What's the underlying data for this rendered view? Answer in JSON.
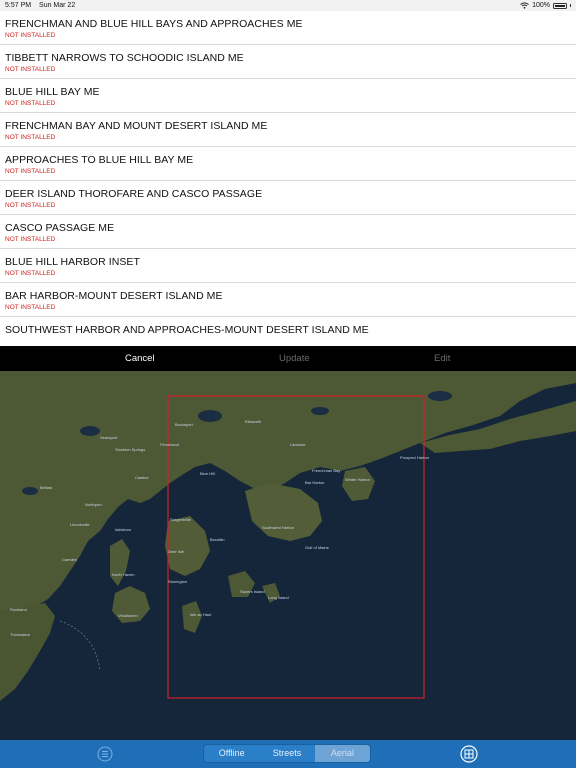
{
  "status_bar": {
    "time": "5:57 PM",
    "date": "Sun Mar 22",
    "battery": "100%",
    "icons": [
      "wifi-icon",
      "battery-icon"
    ]
  },
  "chart_list": [
    {
      "title": "FRENCHMAN AND BLUE HILL BAYS AND APPROACHES  ME",
      "status": "NOT INSTALLED"
    },
    {
      "title": "TIBBETT NARROWS TO SCHOODIC ISLAND  ME",
      "status": "NOT INSTALLED"
    },
    {
      "title": "BLUE HILL BAY  ME",
      "status": "NOT INSTALLED"
    },
    {
      "title": "FRENCHMAN BAY AND MOUNT DESERT ISLAND  ME",
      "status": "NOT INSTALLED"
    },
    {
      "title": "APPROACHES TO BLUE HILL BAY  ME",
      "status": "NOT INSTALLED"
    },
    {
      "title": "DEER ISLAND THOROFARE AND CASCO PASSAGE",
      "status": "NOT INSTALLED"
    },
    {
      "title": "CASCO PASSAGE  ME",
      "status": "NOT INSTALLED"
    },
    {
      "title": "BLUE HILL HARBOR INSET",
      "status": "NOT INSTALLED"
    },
    {
      "title": "BAR HARBOR-MOUNT DESERT ISLAND  ME",
      "status": "NOT INSTALLED"
    },
    {
      "title": "SOUTHWEST HARBOR AND APPROACHES-MOUNT DESERT ISLAND  ME",
      "status": ""
    }
  ],
  "action_bar": {
    "cancel_label": "Cancel",
    "update_label": "Update",
    "edit_label": "Edit"
  },
  "map": {
    "labels": [
      "Frenchman Bay",
      "Bar Harbor",
      "Southwest Harbor",
      "Gulf of Maine",
      "Blue Hill",
      "Stonington",
      "Vinalhaven",
      "Sargentville",
      "Deer Isle",
      "Castine",
      "Belfast",
      "Camden",
      "Ellsworth",
      "Lamoine",
      "Winter Harbor",
      "Isle au Haut",
      "North Haven",
      "Rockland",
      "Searsport",
      "Bucksport",
      "Penobscot",
      "Brooklin",
      "Swan's Island",
      "Long Island",
      "Thomaston",
      "Lincolnville",
      "Northport",
      "Islesboro",
      "Prospect Harbor",
      "Stockton Springs"
    ],
    "colors": {
      "water": "#15263a",
      "land": "#4f5a36",
      "selection": "#d0202a"
    }
  },
  "bottom_bar": {
    "menu_icon": "menu-icon",
    "segments": [
      {
        "label": "Offline",
        "active": false
      },
      {
        "label": "Streets",
        "active": false
      },
      {
        "label": "Aerial",
        "active": true
      }
    ],
    "chart_icon": "grid-icon"
  }
}
